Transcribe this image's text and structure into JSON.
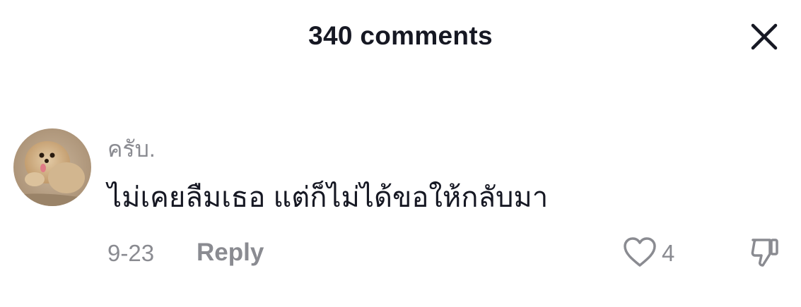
{
  "header": {
    "title": "340 comments",
    "close_icon": "close-icon"
  },
  "comment": {
    "avatar": "user-avatar",
    "username": "ครับ.",
    "text": "ไม่เคยลืมเธอ แต่ก็ไม่ได้ขอให้กลับมา",
    "date": "9-23",
    "reply_label": "Reply",
    "like_icon": "heart-outline-icon",
    "like_count": "4",
    "dislike_icon": "thumbs-down-outline-icon"
  },
  "colors": {
    "text_primary": "#161823",
    "text_secondary": "#8a8b91",
    "background": "#ffffff"
  }
}
